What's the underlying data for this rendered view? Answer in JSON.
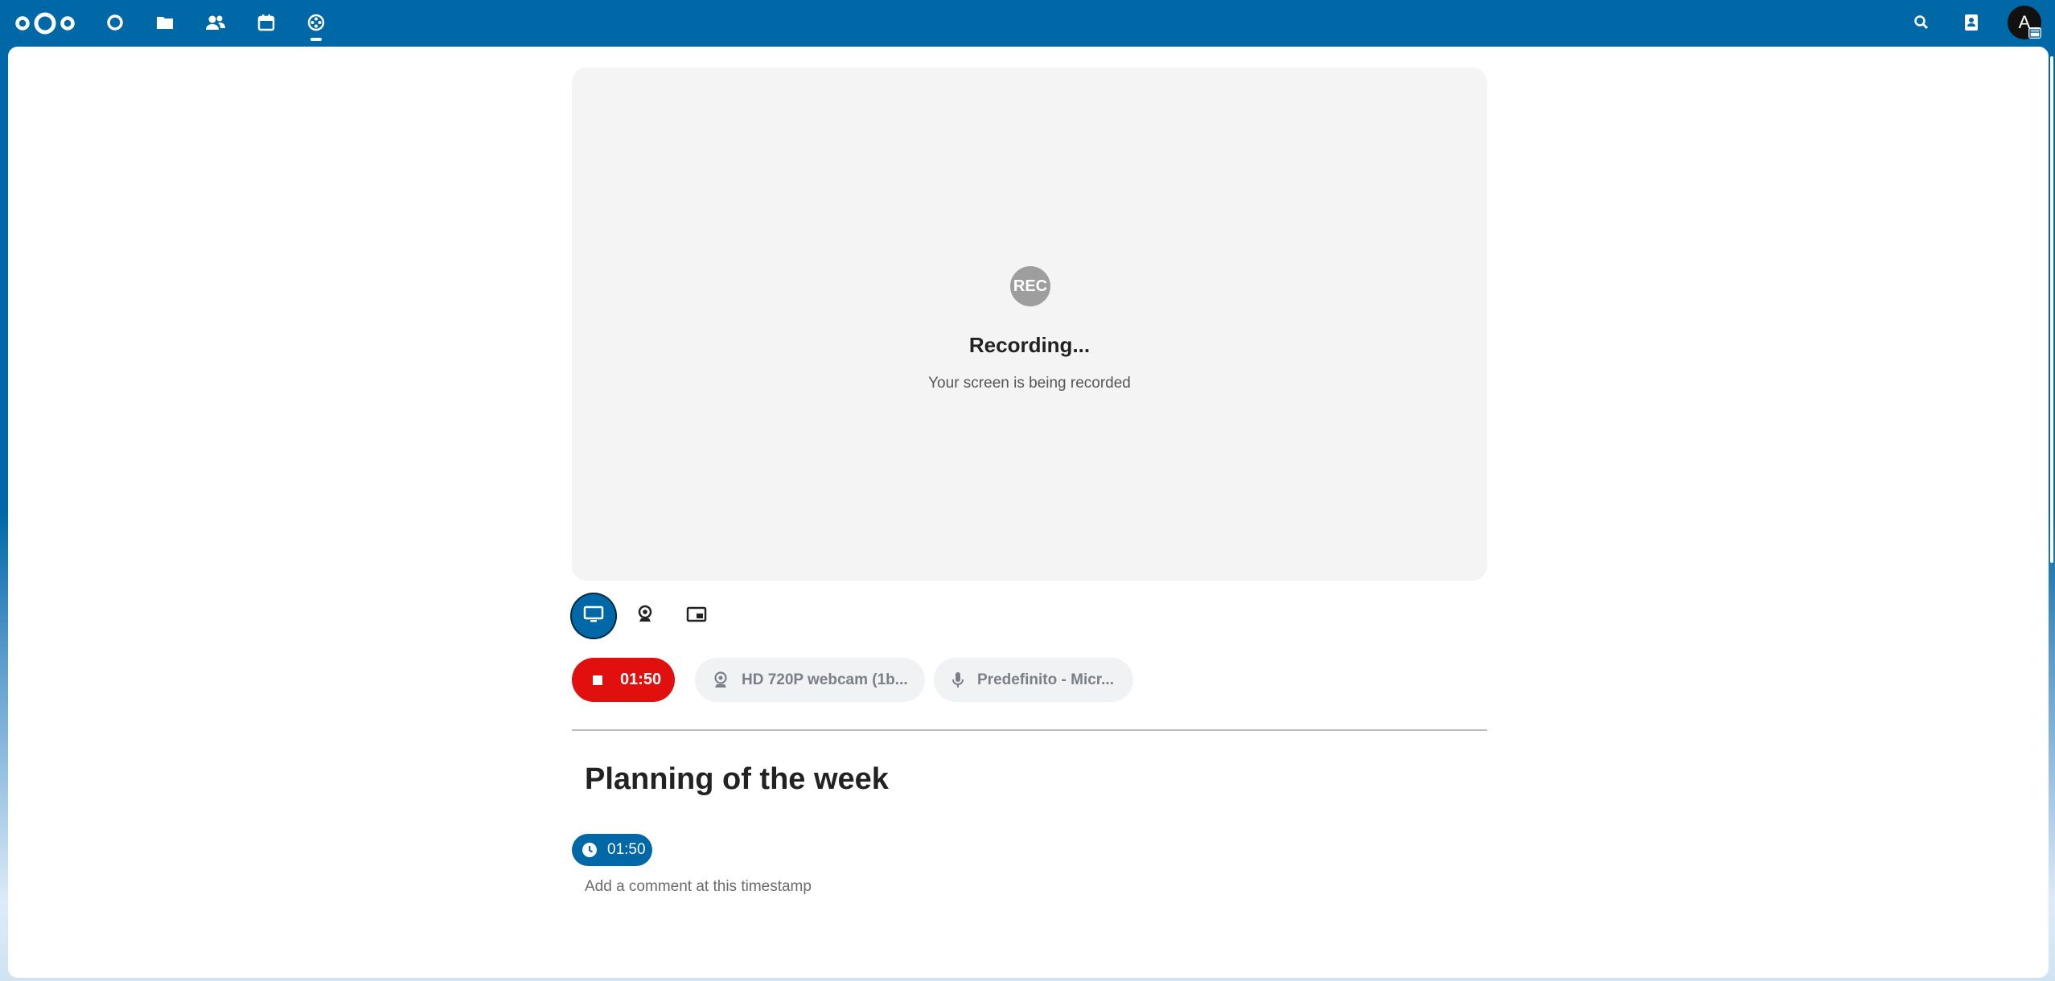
{
  "header": {
    "logo_icon": "nextcloud-logo-icon",
    "nav": [
      {
        "icon": "dashboard-icon"
      },
      {
        "icon": "files-icon"
      },
      {
        "icon": "contacts-icon"
      },
      {
        "icon": "calendar-icon"
      },
      {
        "icon": "recorder-icon",
        "active": true
      }
    ],
    "right": {
      "search_icon": "search-icon",
      "contacts_icon": "contacts-menu-icon",
      "avatar_initial": "A"
    },
    "accent_color": "#0168a7"
  },
  "preview": {
    "badge": "REC",
    "title": "Recording...",
    "subtitle": "Your screen is being recorded"
  },
  "modes": [
    {
      "icon": "screen-icon",
      "active": true
    },
    {
      "icon": "webcam-icon",
      "active": false
    },
    {
      "icon": "picture-in-picture-icon",
      "active": false
    }
  ],
  "controls": {
    "stop_time": "01:50",
    "stop_color": "#e20f0f",
    "camera_label": "HD 720P webcam (1b...",
    "mic_label": "Predefinito - Micr..."
  },
  "recording": {
    "title": "Planning of the week",
    "timestamp": "01:50",
    "comment_placeholder": "Add a comment at this timestamp"
  }
}
